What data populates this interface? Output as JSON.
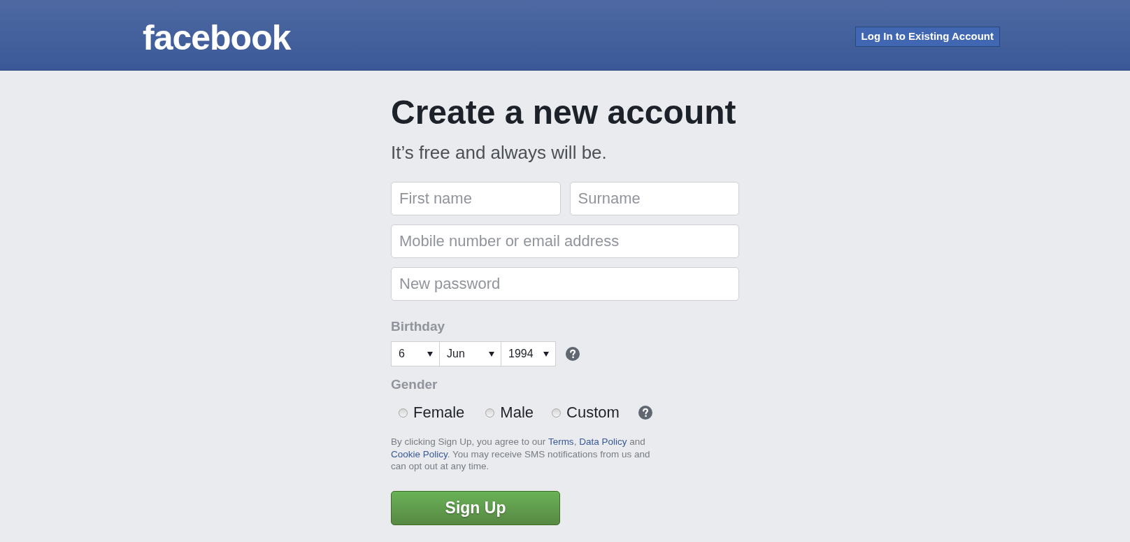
{
  "header": {
    "logo": "facebook",
    "login_button": "Log In to Existing Account"
  },
  "form": {
    "title": "Create a new account",
    "subtitle": "It’s free and always will be.",
    "name_fields": [
      {
        "placeholder": "First name"
      },
      {
        "placeholder": "Surname"
      }
    ],
    "contact_field": {
      "placeholder": "Mobile number or email address"
    },
    "password_field": {
      "placeholder": "New password"
    },
    "birthday": {
      "label": "Birthday",
      "dropdowns": [
        {
          "value": "6"
        },
        {
          "value": "Jun"
        },
        {
          "value": "1994"
        }
      ]
    },
    "gender": {
      "label": "Gender",
      "options": [
        {
          "label": "Female",
          "selected": false
        },
        {
          "label": "Male",
          "selected": false
        },
        {
          "label": "Custom",
          "selected": false
        }
      ]
    },
    "terms": [
      {
        "kind": "text",
        "text": "By clicking Sign Up, you agree to our "
      },
      {
        "kind": "link",
        "text": "Terms"
      },
      {
        "kind": "text",
        "text": ", "
      },
      {
        "kind": "link",
        "text": "Data Policy"
      },
      {
        "kind": "text",
        "text": " and "
      },
      {
        "kind": "link",
        "text": "Cookie Policy"
      },
      {
        "kind": "text",
        "text": ". You may receive SMS notifications from us and can opt out at any time."
      }
    ],
    "submit_button": "Sign Up"
  }
}
